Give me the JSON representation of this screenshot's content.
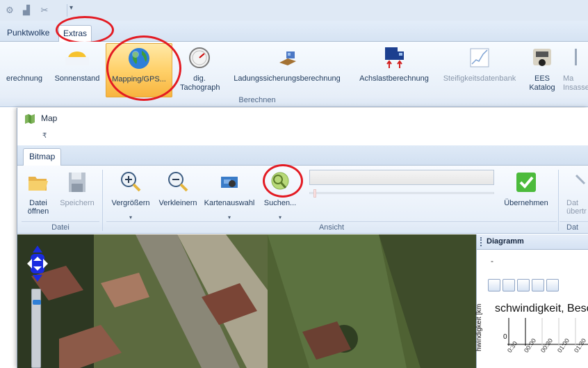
{
  "app": {
    "tabs": [
      {
        "label": "Punktwolke",
        "active": false
      },
      {
        "label": "Extras",
        "active": true
      }
    ],
    "ribbon_buttons": [
      {
        "label": "erechnung",
        "icon": "calculator-icon",
        "dim": false
      },
      {
        "label": "Sonnenstand",
        "icon": "sun-icon",
        "dim": false
      },
      {
        "label": "Mapping/GPS...",
        "icon": "globe-icon",
        "dim": false,
        "highlighted": true
      },
      {
        "label": "dig. Tachograph",
        "icon": "tachograph-icon",
        "dim": false
      },
      {
        "label": "Ladungssicherungsberechnung",
        "icon": "cargo-securing-icon",
        "dim": false
      },
      {
        "label": "Achslastberechnung",
        "icon": "truck-axle-icon",
        "dim": false
      },
      {
        "label": "Steifigkeitsdatenbank",
        "icon": "stiffness-chart-icon",
        "dim": true
      },
      {
        "label": "EES Katalog",
        "icon": "damaged-car-icon",
        "dim": false
      },
      {
        "label": "Ma Insasse",
        "icon": "occupant-icon",
        "dim": true
      }
    ],
    "group_label": "Berechnen"
  },
  "map_window": {
    "title": "Map",
    "qat_dropdown": "₹",
    "tab": "Bitmap",
    "buttons": {
      "open_line1": "Datei",
      "open_line2": "öffnen",
      "save": "Speichern",
      "zoom_in": "Vergrößern",
      "zoom_out": "Verkleinern",
      "map_select": "Kartenauswahl",
      "search": "Suchen...",
      "apply": "Übernehmen",
      "transfer_line1": "Dat",
      "transfer_line2": "übertr"
    },
    "groups": {
      "datei": "Datei",
      "ansicht": "Ansicht",
      "dat": "Dat"
    },
    "search_value": ""
  },
  "diagram": {
    "title": "Diagramm",
    "dash": "-",
    "chart_title": "schwindigkeit, Besch",
    "ylabel": "hwindigkeit [km",
    "zero_label": "0",
    "ticks": [
      "0:30",
      "00:00",
      "00:30",
      "01:00",
      "01:30"
    ]
  },
  "colors": {
    "highlight": "#ffd16a",
    "annotation_circle": "#e31b23",
    "ribbon_bg": "#e6eef8"
  }
}
